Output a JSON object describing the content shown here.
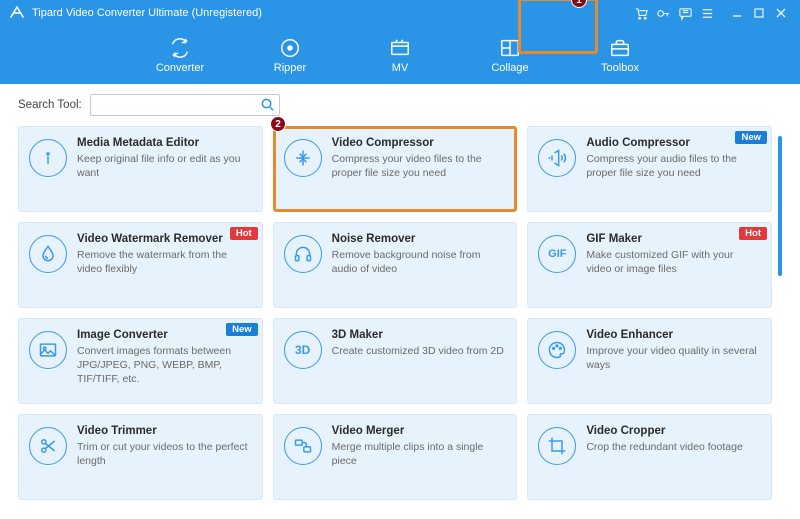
{
  "title": "Tipard Video Converter Ultimate (Unregistered)",
  "nav": {
    "converter": "Converter",
    "ripper": "Ripper",
    "mv": "MV",
    "collage": "Collage",
    "toolbox": "Toolbox"
  },
  "search": {
    "label": "Search Tool:",
    "value": ""
  },
  "badges": {
    "hot": "Hot",
    "new": "New"
  },
  "callouts": {
    "one": "1",
    "two": "2"
  },
  "tools": {
    "media_metadata": {
      "title": "Media Metadata Editor",
      "desc": "Keep original file info or edit as you want"
    },
    "video_compressor": {
      "title": "Video Compressor",
      "desc": "Compress your video files to the proper file size you need"
    },
    "audio_compressor": {
      "title": "Audio Compressor",
      "desc": "Compress your audio files to the proper file size you need"
    },
    "watermark_remover": {
      "title": "Video Watermark Remover",
      "desc": "Remove the watermark from the video flexibly"
    },
    "noise_remover": {
      "title": "Noise Remover",
      "desc": "Remove background noise from audio of video"
    },
    "gif_maker": {
      "title": "GIF Maker",
      "desc": "Make customized GIF with your video or image files"
    },
    "image_converter": {
      "title": "Image Converter",
      "desc": "Convert images formats between JPG/JPEG, PNG, WEBP, BMP, TIF/TIFF, etc."
    },
    "three_d_maker": {
      "title": "3D Maker",
      "desc": "Create customized 3D video from 2D"
    },
    "video_enhancer": {
      "title": "Video Enhancer",
      "desc": "Improve your video quality in several ways"
    },
    "video_trimmer": {
      "title": "Video Trimmer",
      "desc": "Trim or cut your videos to the perfect length"
    },
    "video_merger": {
      "title": "Video Merger",
      "desc": "Merge multiple clips into a single piece"
    },
    "video_cropper": {
      "title": "Video Cropper",
      "desc": "Crop the redundant video footage"
    }
  }
}
